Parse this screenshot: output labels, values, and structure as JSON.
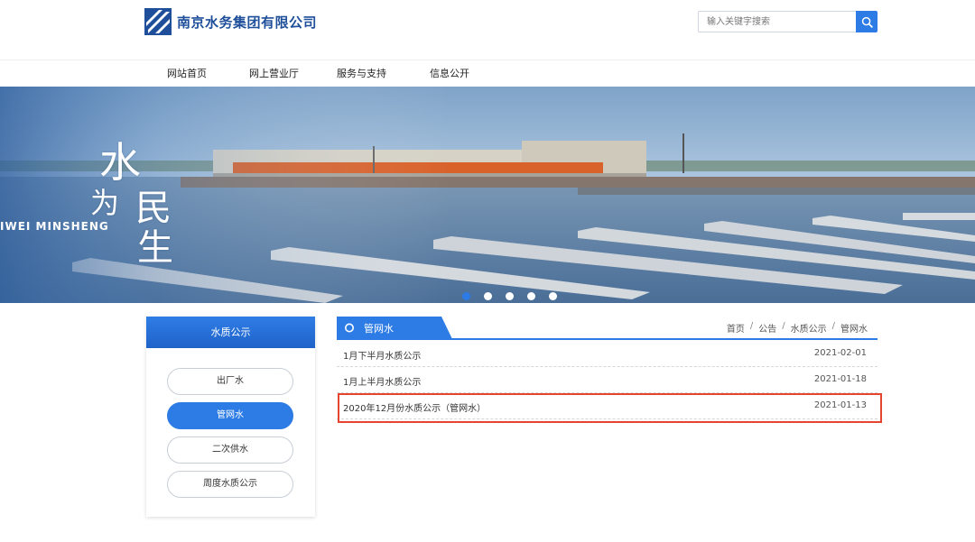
{
  "header": {
    "logo_text": "南京水务集团有限公司",
    "search_placeholder": "输入关键字搜索",
    "accent_color": "#2d7be5",
    "search_icon": "search-icon"
  },
  "nav": {
    "items": [
      {
        "label": "网站首页"
      },
      {
        "label": "网上营业厅"
      },
      {
        "label": "服务与支持"
      },
      {
        "label": "信息公开"
      }
    ]
  },
  "banner": {
    "calligraphy": [
      "水",
      "为",
      "民",
      "生"
    ],
    "pinyin": "IWEI MINSHENG",
    "slide_count": 5,
    "active_slide": 1
  },
  "sidebar": {
    "title": "水质公示",
    "items": [
      {
        "label": "出厂水",
        "active": false
      },
      {
        "label": "管网水",
        "active": true
      },
      {
        "label": "二次供水",
        "active": false
      },
      {
        "label": "周度水质公示",
        "active": false
      }
    ]
  },
  "main": {
    "tab_label": "管网水",
    "breadcrumb": [
      "首页",
      "公告",
      "水质公示",
      "管网水"
    ],
    "breadcrumb_separator": "/",
    "rows": [
      {
        "title": "1月下半月水质公示",
        "date": "2021-02-01"
      },
      {
        "title": "1月上半月水质公示",
        "date": "2021-01-18"
      },
      {
        "title": "2020年12月份水质公示（管网水）",
        "date": "2021-01-13",
        "highlighted": true
      }
    ],
    "highlight_color": "#e5452f"
  }
}
